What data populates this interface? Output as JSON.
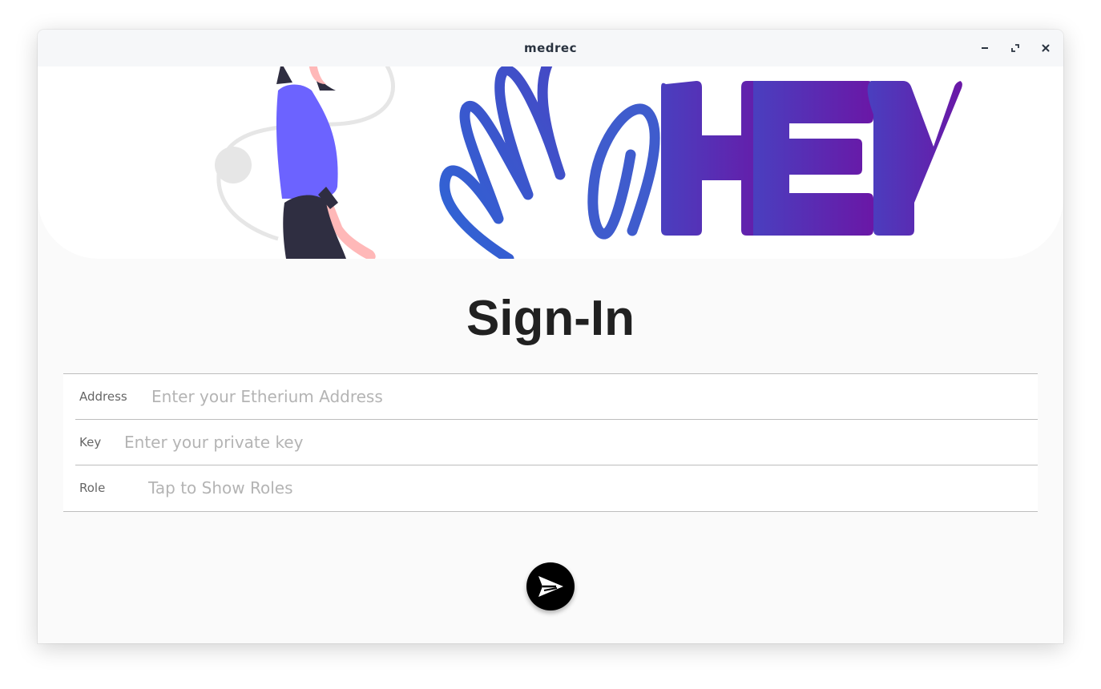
{
  "window": {
    "title": "medrec",
    "controls": [
      "minimize-icon",
      "maximize-icon",
      "close-icon"
    ]
  },
  "banner": {
    "logo_text": "HEY",
    "illustration": "woman-waving-illustration"
  },
  "page": {
    "heading": "Sign-In"
  },
  "form": {
    "address": {
      "label": "Address",
      "placeholder": "Enter your Etherium Address",
      "value": ""
    },
    "key": {
      "label": "Key",
      "placeholder": "Enter your private key",
      "value": ""
    },
    "role": {
      "label": "Role",
      "placeholder": "Tap to Show Roles"
    }
  },
  "submit": {
    "icon": "send-icon"
  },
  "colors": {
    "logo_gradient_start": "#4a3fbf",
    "logo_gradient_end": "#6a17a6",
    "wave_hand": "#3d5ccf",
    "person_shirt": "#6c63ff",
    "fab": "#000000"
  }
}
